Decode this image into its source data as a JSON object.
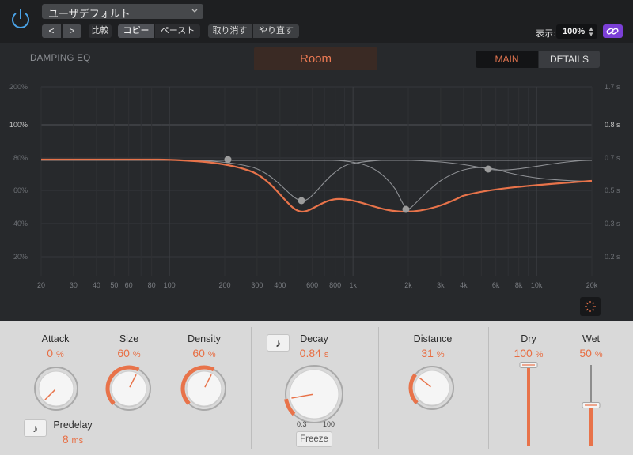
{
  "header": {
    "preset_name": "ユーザデフォルト",
    "nav_back": "<",
    "nav_forward": ">",
    "compare_label": "比較",
    "copy_label": "コピー",
    "paste_label": "ペースト",
    "undo_label": "取り消す",
    "redo_label": "やり直す",
    "zoom_label": "表示:",
    "zoom_value": "100%"
  },
  "eq": {
    "section_label": "DAMPING EQ",
    "room_tab": "Room",
    "main_tab": "MAIN",
    "details_tab": "DETAILS",
    "left_ticks": [
      "200%",
      "100%",
      "80%",
      "60%",
      "40%",
      "20%"
    ],
    "right_ticks": [
      "1.7 s",
      "0.8 s",
      "0.7 s",
      "0.5 s",
      "0.3 s",
      "0.2 s"
    ],
    "freq_ticks": [
      "20",
      "30",
      "40",
      "50",
      "60",
      "80",
      "100",
      "200",
      "300",
      "400",
      "600",
      "800",
      "1k",
      "2k",
      "3k",
      "4k",
      "6k",
      "8k",
      "10k",
      "20k"
    ],
    "colors": {
      "curve": "#e8734a",
      "node": "#9a9a9a",
      "grid": "#3a3c40"
    }
  },
  "controls": {
    "attack": {
      "label": "Attack",
      "value": "0",
      "unit": "%",
      "level": 0.0
    },
    "size": {
      "label": "Size",
      "value": "60",
      "unit": "%",
      "level": 0.6
    },
    "density": {
      "label": "Density",
      "value": "60",
      "unit": "%",
      "level": 0.6
    },
    "predelay": {
      "label": "Predelay",
      "value": "8",
      "unit": "ms"
    },
    "decay": {
      "label": "Decay",
      "value": "0.84",
      "unit": "s",
      "scale_min": "0.3",
      "scale_max": "100",
      "freeze_label": "Freeze",
      "level": 0.13
    },
    "distance": {
      "label": "Distance",
      "value": "31",
      "unit": "%",
      "level": 0.31
    },
    "dry": {
      "label": "Dry",
      "value": "100",
      "unit": "%",
      "level": 1.0
    },
    "wet": {
      "label": "Wet",
      "value": "50",
      "unit": "%",
      "level": 0.5
    },
    "accent": "#e8734a"
  }
}
